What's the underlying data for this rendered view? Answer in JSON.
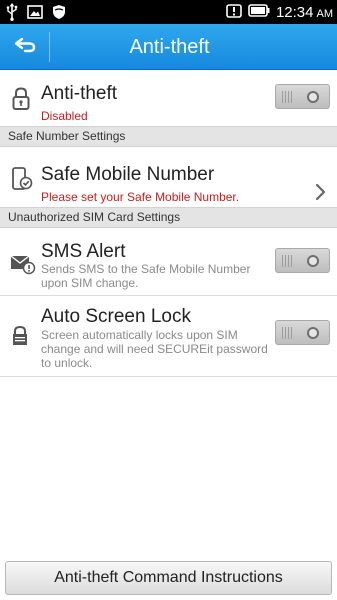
{
  "status_bar": {
    "time": "12:34",
    "ampm": "AM",
    "icons": [
      "usb-icon",
      "image-icon",
      "shield-icon",
      "alert-icon",
      "battery-icon"
    ]
  },
  "header": {
    "title": "Anti-theft",
    "back_icon": "back-arrow-icon"
  },
  "anti_theft": {
    "title": "Anti-theft",
    "status": "Disabled",
    "icon": "lock-icon",
    "toggle_on": false
  },
  "sections": {
    "safe_number": "Safe Number Settings",
    "unauthorized_sim": "Unauthorized SIM Card Settings"
  },
  "safe_number": {
    "title": "Safe Mobile Number",
    "subtitle": "Please set your Safe Mobile Number.",
    "icon": "phone-check-icon"
  },
  "sms_alert": {
    "title": "SMS Alert",
    "description": "Sends SMS to the Safe Mobile Number upon SIM change.",
    "icon": "sms-alert-icon",
    "toggle_on": false
  },
  "auto_lock": {
    "title": "Auto Screen Lock",
    "description": "Screen automatically locks upon SIM change and will need SECUREit password to unlock.",
    "icon": "padlock-icon",
    "toggle_on": false
  },
  "footer": {
    "button_label": "Anti-theft Command Instructions"
  },
  "colors": {
    "header_blue": "#1f9ae6",
    "warning_red": "#cc1b1b",
    "section_gray": "#e4e4e4"
  }
}
